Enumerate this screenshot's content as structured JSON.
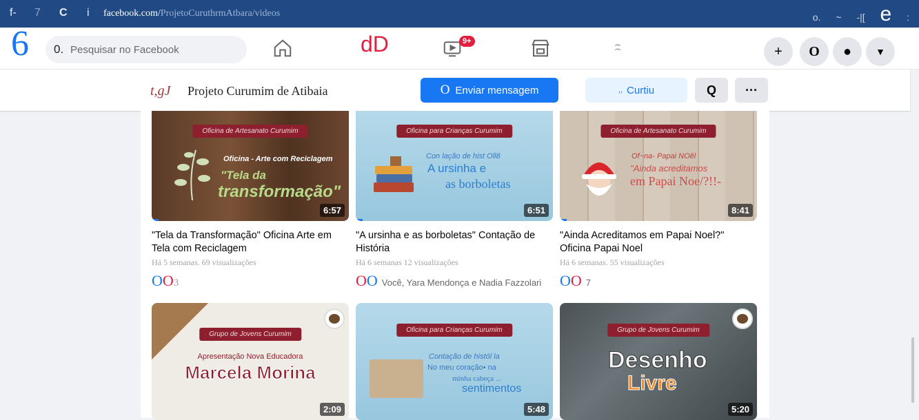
{
  "browser": {
    "nav_left": "f-",
    "nav_num": "7",
    "reload": "C",
    "info": "i",
    "url_main": "facebook.com/",
    "url_rest": "ProjetoCuruthrmAtbara/videos",
    "right_a": "o.",
    "right_b": "~",
    "right_c": "-|[",
    "right_e": "e",
    "right_dots": ":"
  },
  "fb": {
    "logo": "6",
    "search_icon_text": "0.",
    "search_placeholder": "Pesquisar no Facebook",
    "nav_text": "dD",
    "watch_badge": "9+",
    "menu_plus": "+",
    "menu_o": "O",
    "menu_dot": "●",
    "menu_arrow": "▼"
  },
  "page_header": {
    "logo_text": "t,gJ",
    "title": "Projeto Curumim de Atibaia",
    "message_icon": "O",
    "message_label": "Enviar mensagem",
    "like_icon": ",,",
    "like_label": "Curtiu",
    "search_icon": "Q",
    "more_icon": "···"
  },
  "videos": [
    {
      "tag": "Oficina de Artesanato Curumim",
      "thumb_line1": "Oficina - Arte com Reciclagem",
      "thumb_line2": "\"Tela da",
      "thumb_line3": "transformação\"",
      "duration": "6:57",
      "title": "\"Tela da Transformação\" Oficina Arte em Tela com Reciclagem",
      "meta": "Há 5 semanas. 69 visualizações",
      "react_a": "O",
      "react_b": "O",
      "react_count": "3"
    },
    {
      "tag": "Oficina para Crianças Curumim",
      "thumb_line1": "Con lação de hist Oll8",
      "thumb_line2": "A ursinha e",
      "thumb_line3": "as borboletas",
      "duration": "6:51",
      "title": "\"A ursinha e as borboletas\" Contação de História",
      "meta": "Há 6 semanas 12 visualizações",
      "react_a": "O",
      "react_b": "O",
      "react_count": "Você, Yara Mendonça e Nadia Fazzolari"
    },
    {
      "tag": "Oficina de Artesanato Curumim",
      "thumb_line1": "Of~na- Papai NOêl",
      "thumb_line2": "\"Ainda acreditamos",
      "thumb_line3": "em Papai Noe/?!!-",
      "duration": "8:41",
      "title": "\"Ainda Acreditamos em Papai Noel?\" Oficina Papai Noel",
      "meta": "Há 6 semanas. 55 visualizações",
      "react_a": "O",
      "react_b": "O",
      "react_count": "7"
    },
    {
      "tag": "Grupo de Jovens Curumim",
      "thumb_line1": "Apresentação Nova Educadora",
      "thumb_line2": "Marcela Morina",
      "duration": "2:09"
    },
    {
      "tag": "Oficina para Crianças Curumim",
      "thumb_line1": "Contação de histól la",
      "thumb_line2": "No meu coração• na",
      "thumb_line3": "minha cabeça ...",
      "thumb_line4": "sentimentos",
      "duration": "5:48"
    },
    {
      "tag": "Grupo de Jovens Curumim",
      "thumb_line1": "Desenho",
      "thumb_line2": "Livre",
      "duration": "5:20"
    }
  ]
}
